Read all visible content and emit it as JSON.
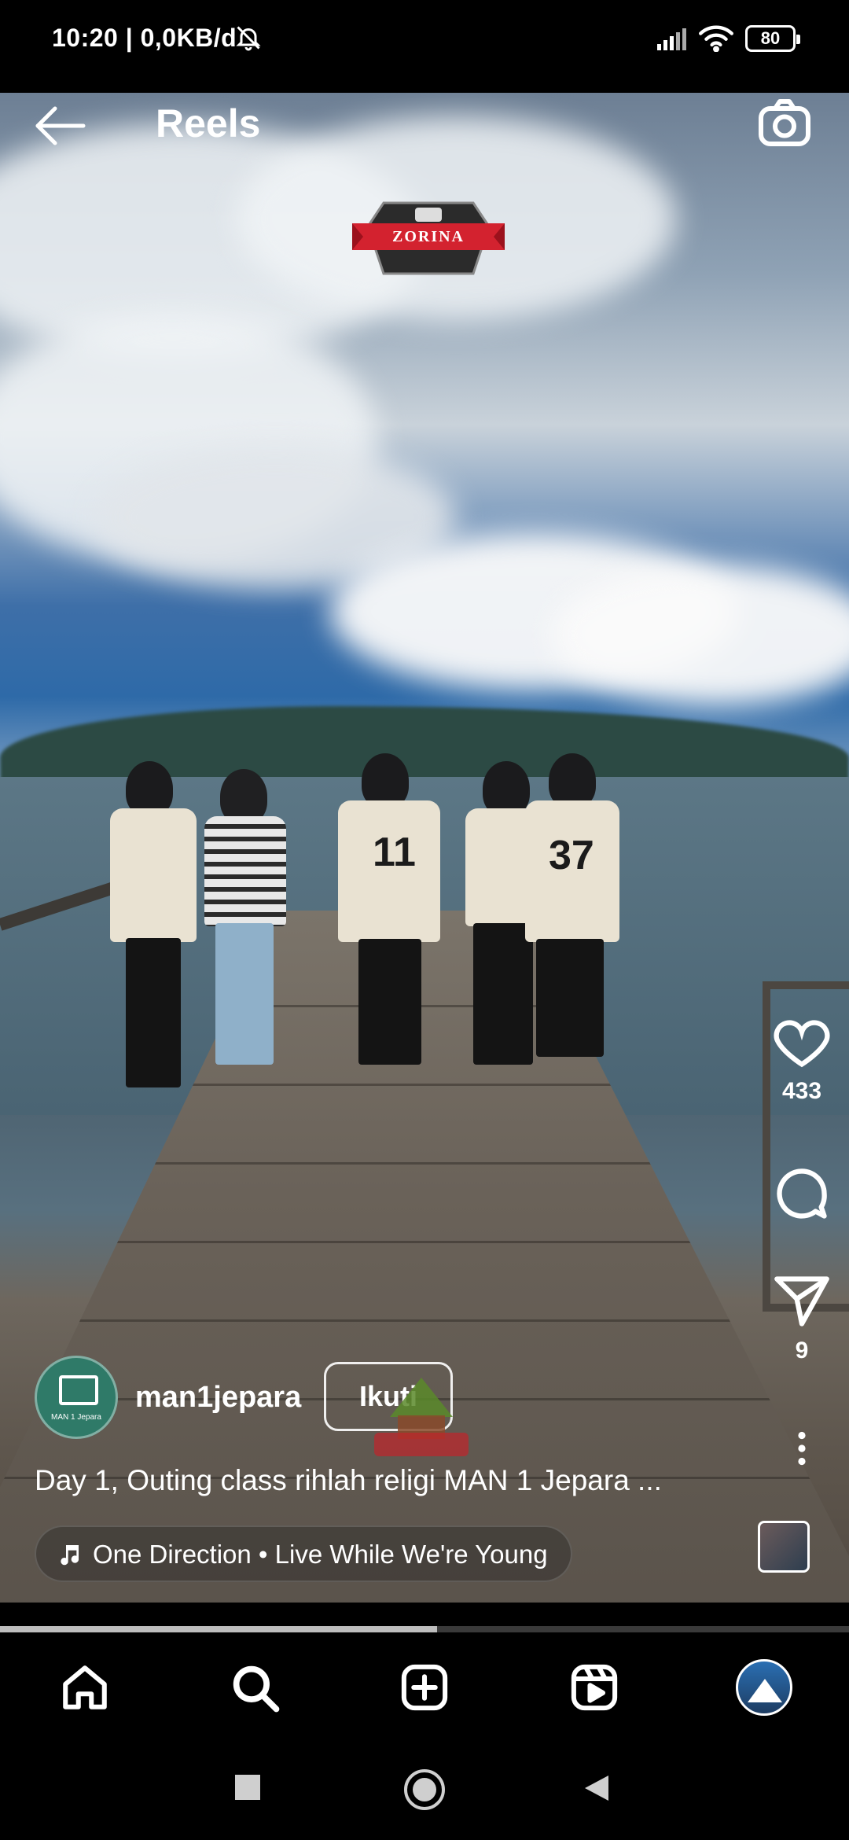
{
  "status_bar": {
    "time_speed": "10:20 | 0,0KB/d",
    "battery": "80"
  },
  "header": {
    "title": "Reels"
  },
  "video": {
    "watermark": "ZORINA",
    "jersey_numbers": [
      "11",
      "37"
    ]
  },
  "actions": {
    "likes": "433",
    "shares": "9"
  },
  "post": {
    "username": "man1jepara",
    "follow_label": "Ikuti",
    "avatar_caption": "MAN 1 Jepara",
    "caption": "Day 1, Outing class rihlah religi MAN 1 Jepara ...",
    "music": "One Direction • Live While We're Young"
  },
  "progress_fraction": 0.515,
  "icons": {
    "back": "arrow-left-icon",
    "camera": "camera-icon",
    "like": "heart-icon",
    "comment": "comment-icon",
    "share": "send-icon",
    "more": "more-vertical-icon",
    "music": "music-note-icon"
  },
  "bottom_nav": [
    "home",
    "search",
    "create",
    "reels",
    "profile"
  ]
}
